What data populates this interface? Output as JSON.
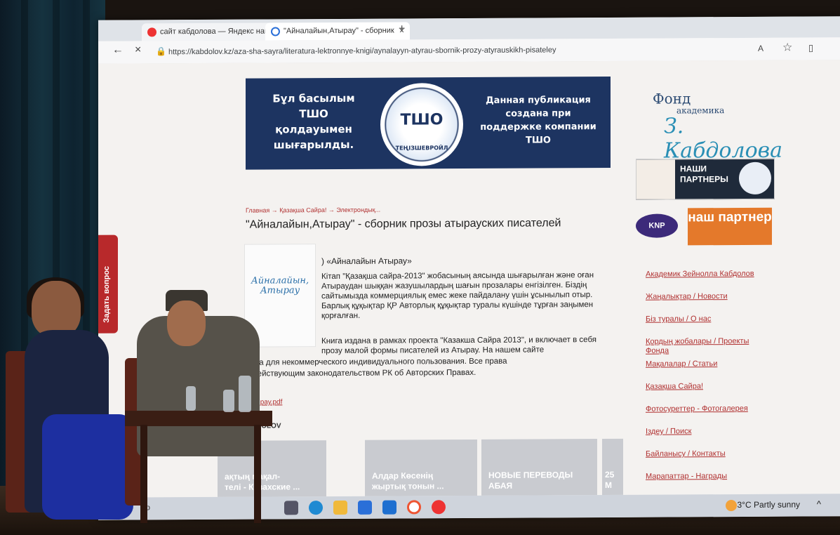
{
  "browser": {
    "tabs": [
      {
        "label": "сайт кабдолова — Яндекс наш"
      },
      {
        "label": "\"Айналайын,Атырау\" - сборник"
      }
    ],
    "url": "https://kabdolov.kz/aza-sha-sayra/literatura-lektronnye-knigi/aynalayyn-atyrau-sbornik-prozy-atyrauskikh-pisateley"
  },
  "banner": {
    "left_text": "Бұл басылым ТШО қолдауымен шығарылды.",
    "logo_text": "ТШО",
    "logo_caption": "ТЕҢІЗШЕВРОЙЛ",
    "right_text": "Данная публикация создана при поддержке компании ТШО"
  },
  "breadcrumbs": "Главная → Қазақша Сайра! → Электрондық...",
  "article": {
    "title": "\"Айналайын,Атырау\" - сборник прозы атырауских писателей",
    "book_cover_title": "Айналайын, Атырау",
    "book_heading": ")  «Айналайын Атырау»",
    "para_kz": "Кітап \"Қазақша сайра-2013\" жобасының аясында шығарылған және оған Атыраудан шыққан жазушылардың шағын прозалары енгізілген. Біздің сайтымызда коммерциялық емес жеке пайдалану үшін ұсынылып отыр. Барлық құқықтар ҚР Авторлық құқықтар туралы күшінде тұрған заңымен қорғалған.",
    "para_ru_1": "Книга издана в рамках проекта \"Казакша Сайра 2013\", и включает в себя прозу малой формы писателей из Атырау. На нашем сайте",
    "para_ru_2": "дставлена для некоммерческого индивидуального пользования. Все права",
    "para_ru_3": "ищены действующим законодательством РК об Авторских Правах.",
    "pdf_link": "айын +Атырау.pdf",
    "also_on": "O ON KABDOLOV"
  },
  "cards": [
    {
      "label": "ақтың мақал-\nтелі - Казахские ..."
    },
    {
      "label": "Алдар Көсенің\nжыртық тонын ..."
    },
    {
      "label": "НОВЫЕ ПЕРЕВОДЫ\nАБАЯ"
    },
    {
      "label": "25\nМ"
    }
  ],
  "sidebar": {
    "fund_line1": "Фонд",
    "fund_line2": "академика",
    "fund_name": "З. Кабдолова",
    "partners_label": "НАШИ ПАРТНЕРЫ",
    "knp_logo": "KNP",
    "knp_label": "наш партнер",
    "links": [
      "Академик Зейнолла Кабдолов",
      "Жаңалықтар / Новости",
      "Біз туралы / О нас",
      "Қордың жобалары / Проекты Фонда",
      "Мақалалар / Статьи",
      "Қазақша Сайра!",
      "Фотосуреттер - Фотогалерея",
      "Іздеу / Поиск",
      "Байланысу / Контакты",
      "Марапаттар - Награды"
    ]
  },
  "feedback_tab": "Задать вопрос",
  "taskbar": {
    "weather": "3°C  Partly sunny",
    "search_hint": "По"
  },
  "colors": {
    "banner_bg": "#1d3461",
    "link_red": "#b03030",
    "feedback_red": "#b8292b",
    "knp_orange": "#e4792b"
  }
}
